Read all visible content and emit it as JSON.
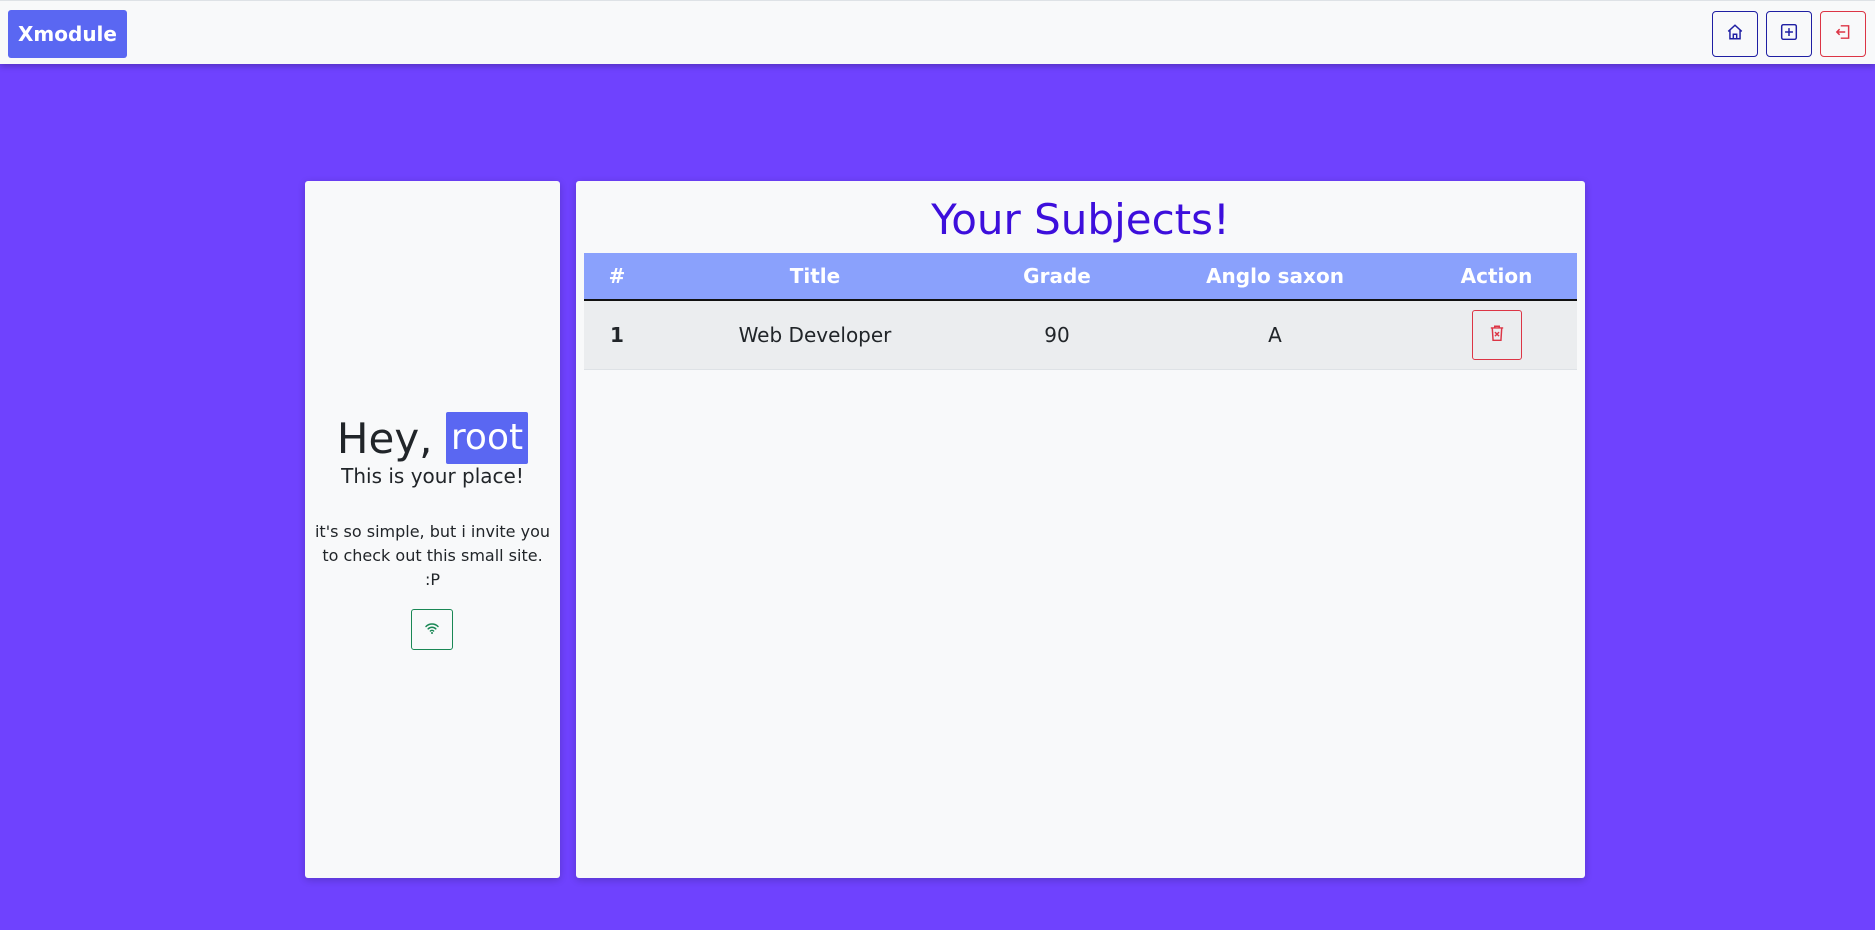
{
  "navbar": {
    "brand": "Xmodule",
    "buttons": {
      "home_icon": "home-icon",
      "add_icon": "plus-square-icon",
      "logout_icon": "logout-icon"
    }
  },
  "profile": {
    "greeting_prefix": "Hey,",
    "username": "root",
    "tagline": "This is your place!",
    "blurb": "it's so simple, but i invite you to check out this small site. :P",
    "wifi_icon": "wifi-icon"
  },
  "subjects": {
    "title": "Your Subjects!",
    "columns": [
      "#",
      "Title",
      "Grade",
      "Anglo saxon",
      "Action"
    ],
    "rows": [
      {
        "index": "1",
        "title": "Web Developer",
        "grade": "90",
        "anglo_saxon": "A",
        "action_icon": "trash-x-icon"
      }
    ]
  },
  "colors": {
    "background": "#6f42fe",
    "brand": "#5a67f2",
    "title": "#3d0fdc",
    "table_header": "#8aa1fc",
    "danger": "#dc3545",
    "success": "#198754"
  }
}
